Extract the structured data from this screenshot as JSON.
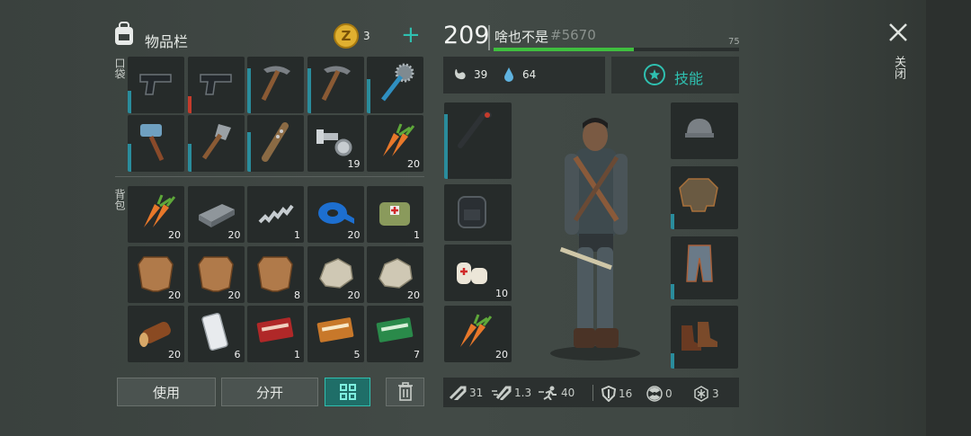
{
  "inventory": {
    "title": "物品栏",
    "coins": "3",
    "pockets_label": "口袋",
    "backpack_label": "背包",
    "pockets": [
      {
        "icon": "pistol-icon",
        "count": "",
        "durability": 0.4,
        "dur_color": "teal"
      },
      {
        "icon": "pistol-icon",
        "count": "",
        "durability": 0.3,
        "dur_color": "red"
      },
      {
        "icon": "pickaxe-icon",
        "count": "",
        "durability": 0.8,
        "dur_color": "teal"
      },
      {
        "icon": "pickaxe-icon",
        "count": "",
        "durability": 0.8,
        "dur_color": "teal"
      },
      {
        "icon": "spiked-club-icon",
        "count": "",
        "durability": 0.6,
        "dur_color": "teal"
      },
      {
        "icon": "sledgehammer-icon",
        "count": "",
        "durability": 0.5,
        "dur_color": "teal"
      },
      {
        "icon": "shovel-icon",
        "count": "",
        "durability": 0.5,
        "dur_color": "teal"
      },
      {
        "icon": "nail-bat-icon",
        "count": "",
        "durability": 0.7,
        "dur_color": "teal"
      },
      {
        "icon": "bolt-nut-icon",
        "count": "19",
        "durability": 0,
        "dur_color": "teal"
      },
      {
        "icon": "carrot-icon",
        "count": "20",
        "durability": 0,
        "dur_color": "teal"
      }
    ],
    "backpack": [
      {
        "icon": "carrot-icon",
        "count": "20"
      },
      {
        "icon": "metal-bar-icon",
        "count": "20"
      },
      {
        "icon": "spring-icon",
        "count": "1"
      },
      {
        "icon": "tape-icon",
        "count": "20"
      },
      {
        "icon": "medkit-bag-icon",
        "count": "1"
      },
      {
        "icon": "leather-icon",
        "count": "20"
      },
      {
        "icon": "leather-icon",
        "count": "20"
      },
      {
        "icon": "leather-icon",
        "count": "8"
      },
      {
        "icon": "stone-icon",
        "count": "20"
      },
      {
        "icon": "stone-icon",
        "count": "20"
      },
      {
        "icon": "log-icon",
        "count": "20"
      },
      {
        "icon": "phone-icon",
        "count": "6"
      },
      {
        "icon": "coupon-red-icon",
        "count": "1"
      },
      {
        "icon": "coupon-orange-icon",
        "count": "5"
      },
      {
        "icon": "coupon-green-icon",
        "count": "7"
      }
    ],
    "use_button": "使用",
    "split_button": "分开"
  },
  "character": {
    "level": "209",
    "name": "啥也不是",
    "tag": "#5670",
    "xp_max": "75",
    "xp_progress": 0.57,
    "food": "39",
    "water": "64",
    "skills_label": "技能",
    "equip_left": [
      {
        "icon": "crowbar-icon",
        "count": ""
      },
      {
        "icon": "backpack-icon",
        "count": ""
      },
      {
        "icon": "bandage-icon",
        "count": "10"
      },
      {
        "icon": "carrot-icon",
        "count": "20"
      }
    ],
    "equip_right": [
      {
        "icon": "helmet-icon"
      },
      {
        "icon": "jacket-icon"
      },
      {
        "icon": "pants-icon"
      },
      {
        "icon": "boots-icon"
      }
    ],
    "stats": {
      "attack": "31",
      "attack_speed": "1.3",
      "speed": "40",
      "armor": "16",
      "radiation": "0",
      "cold": "3"
    }
  },
  "close_label": "关闭",
  "colors": {
    "accent": "#2fc0b0",
    "xp_bar": "#3fbf3f",
    "coin": "#e0b030"
  }
}
